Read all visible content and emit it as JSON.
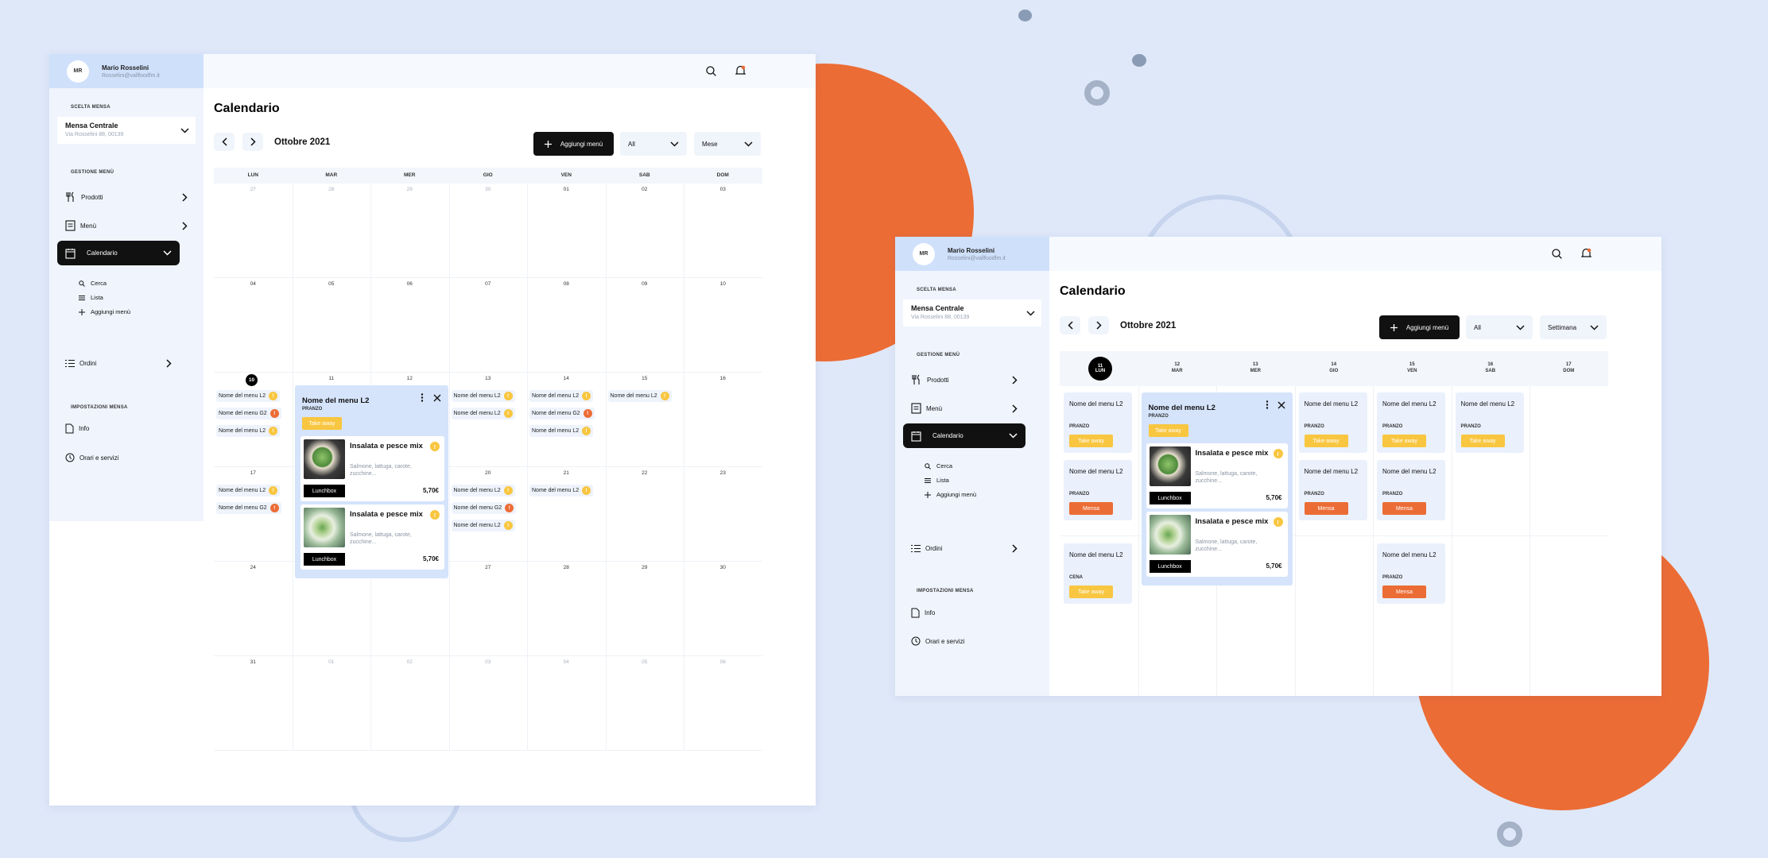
{
  "colors": {
    "background": "#dfe8f9",
    "accent_orange": "#ec6c35",
    "badge_yellow": "#f8c640",
    "badge_orange": "#ec6c35",
    "active_nav": "#111111",
    "sidebar": "#eff4fd",
    "profile": "#cfe0fb"
  },
  "user": {
    "initials": "MR",
    "name": "Mario Rosselini",
    "email": "Rosselini@vallfoodfm.it"
  },
  "sidebar": {
    "mensa_section": "SCELTA MENSA",
    "mensa_name": "Mensa Centrale",
    "mensa_address": "Via Rosselini 88, 00139",
    "gestione_section": "GESTIONE MENÙ",
    "items": [
      {
        "label": "Prodotti",
        "icon": "fork-knife-icon"
      },
      {
        "label": "Menù",
        "icon": "menu-book-icon"
      },
      {
        "label": "Calendario",
        "icon": "calendar-icon"
      }
    ],
    "subitems": [
      {
        "label": "Cerca",
        "icon": "search-icon"
      },
      {
        "label": "Lista",
        "icon": "list-icon"
      },
      {
        "label": "Aggiungi menù",
        "icon": "plus-icon"
      }
    ],
    "ordini": "Ordini",
    "impostazioni_section": "IMPOSTAZIONI MENSA",
    "info": "Info",
    "orari": "Orari e servizi"
  },
  "page": {
    "title": "Calendario",
    "month": "Ottobre 2021",
    "add_button": "Aggiungi menù",
    "filter_value": "All",
    "view_month": "Mese",
    "view_week": "Settimana"
  },
  "month_view": {
    "weekdays": [
      "LUN",
      "MAR",
      "MER",
      "GIO",
      "VEN",
      "SAB",
      "DOM"
    ],
    "weeks": [
      [
        "27",
        "28",
        "29",
        "30",
        "01",
        "02",
        "03"
      ],
      [
        "04",
        "05",
        "06",
        "07",
        "08",
        "09",
        "10"
      ],
      [
        "10",
        "11",
        "12",
        "13",
        "14",
        "15",
        "16"
      ],
      [
        "17",
        "18",
        "19",
        "20",
        "21",
        "22",
        "23"
      ],
      [
        "24",
        "25",
        "26",
        "27",
        "28",
        "29",
        "30"
      ],
      [
        "31",
        "01",
        "02",
        "03",
        "04",
        "05",
        "06"
      ]
    ],
    "entry_label": "Nome del menu L2",
    "entry_label_g2": "Nome del menu G2"
  },
  "popup": {
    "title": "Nome del menu L2",
    "meal": "PRANZO",
    "tag": "Take away",
    "dishes": [
      {
        "name": "Insalata e pesce mix",
        "desc": "Salmone, lattuga, carote, zucchine...",
        "price": "5,70€",
        "type": "Lunchbox"
      },
      {
        "name": "Insalata e pesce mix",
        "desc": "Salmone, lattuga, carote, zucchine...",
        "price": "5,70€",
        "type": "Lunchbox"
      }
    ]
  },
  "week_view": {
    "days": [
      {
        "num": "11",
        "name": "LUN"
      },
      {
        "num": "12",
        "name": "MAR"
      },
      {
        "num": "13",
        "name": "MER"
      },
      {
        "num": "14",
        "name": "GIO"
      },
      {
        "num": "15",
        "name": "VEN"
      },
      {
        "num": "16",
        "name": "SAB"
      },
      {
        "num": "17",
        "name": "DOM"
      }
    ],
    "menu_name": "Nome del menu L2",
    "lunch": "PRANZO",
    "dinner": "CENA",
    "take_away": "Take away",
    "mensa": "Mensa"
  }
}
